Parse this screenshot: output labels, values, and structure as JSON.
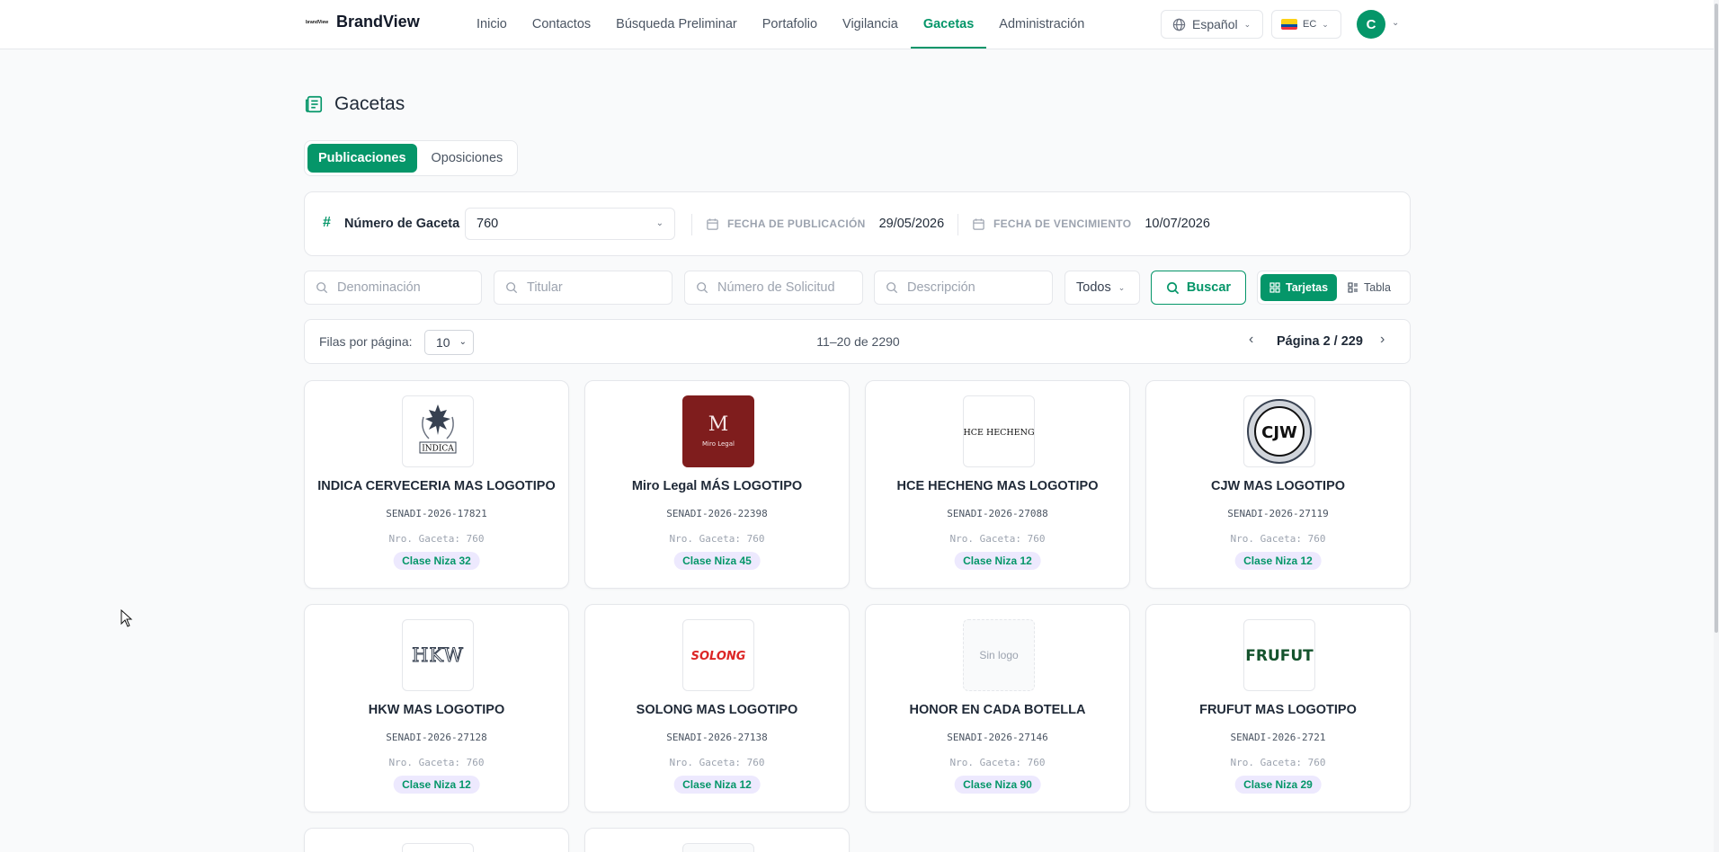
{
  "brand": {
    "mark": "brandView",
    "name": "BrandView"
  },
  "nav": [
    {
      "label": "Inicio",
      "active": false
    },
    {
      "label": "Contactos",
      "active": false
    },
    {
      "label": "Búsqueda Preliminar",
      "active": false
    },
    {
      "label": "Portafolio",
      "active": false
    },
    {
      "label": "Vigilancia",
      "active": false
    },
    {
      "label": "Gacetas",
      "active": true
    },
    {
      "label": "Administración",
      "active": false
    }
  ],
  "header": {
    "language": "Español",
    "country": "EC",
    "avatar_initial": "C"
  },
  "page": {
    "title": "Gacetas"
  },
  "tabs": [
    {
      "label": "Publicaciones",
      "active": true
    },
    {
      "label": "Oposiciones",
      "active": false
    }
  ],
  "filters": {
    "gaceta_label": "Número de Gaceta",
    "gaceta_value": "760",
    "pub_date_label": "FECHA DE PUBLICACIÓN",
    "pub_date_value": "29/05/2026",
    "exp_date_label": "FECHA DE VENCIMIENTO",
    "exp_date_value": "10/07/2026"
  },
  "search": {
    "denominacion_placeholder": "Denominación",
    "titular_placeholder": "Titular",
    "solicitud_placeholder": "Número de Solicitud",
    "descripcion_placeholder": "Descripción",
    "status_value": "Todos",
    "search_button": "Buscar",
    "view_cards": "Tarjetas",
    "view_table": "Tabla"
  },
  "pagination": {
    "rows_label": "Filas por página:",
    "rows_value": "10",
    "range": "11–20 de 2290",
    "page": "Página 2 / 229"
  },
  "cards": [
    {
      "title": "INDICA CERVECERIA MAS LOGOTIPO",
      "code": "SENADI-2026-17821",
      "gaceta": "Nro. Gaceta: 760",
      "badge": "Clase Niza 32",
      "logo_text": "INDICA"
    },
    {
      "title": "Miro Legal MÁS LOGOTIPO",
      "code": "SENADI-2026-22398",
      "gaceta": "Nro. Gaceta: 760",
      "badge": "Clase Niza 45",
      "logo_text": "Miro Legal"
    },
    {
      "title": "HCE HECHENG MAS LOGOTIPO",
      "code": "SENADI-2026-27088",
      "gaceta": "Nro. Gaceta: 760",
      "badge": "Clase Niza 12",
      "logo_text": "HCE HECHENG"
    },
    {
      "title": "CJW MAS LOGOTIPO",
      "code": "SENADI-2026-27119",
      "gaceta": "Nro. Gaceta: 760",
      "badge": "Clase Niza 12",
      "logo_text": "CJW"
    },
    {
      "title": "HKW MAS LOGOTIPO",
      "code": "SENADI-2026-27128",
      "gaceta": "Nro. Gaceta: 760",
      "badge": "Clase Niza 12",
      "logo_text": "HKW"
    },
    {
      "title": "SOLONG MAS LOGOTIPO",
      "code": "SENADI-2026-27138",
      "gaceta": "Nro. Gaceta: 760",
      "badge": "Clase Niza 12",
      "logo_text": "SOLONG"
    },
    {
      "title": "HONOR EN CADA BOTELLA",
      "code": "SENADI-2026-27146",
      "gaceta": "Nro. Gaceta: 760",
      "badge": "Clase Niza 90",
      "logo_text": "Sin logo"
    },
    {
      "title": "FRUFUT MAS LOGOTIPO",
      "code": "SENADI-2026-2721",
      "gaceta": "Nro. Gaceta: 760",
      "badge": "Clase Niza 29",
      "logo_text": "FRUFUT"
    }
  ],
  "colors": {
    "accent": "#059669",
    "badge_bg": "#ede9fe",
    "miro_bg": "#7f1d1d",
    "solong_red": "#dc2626",
    "frufut_green": "#14532d"
  }
}
